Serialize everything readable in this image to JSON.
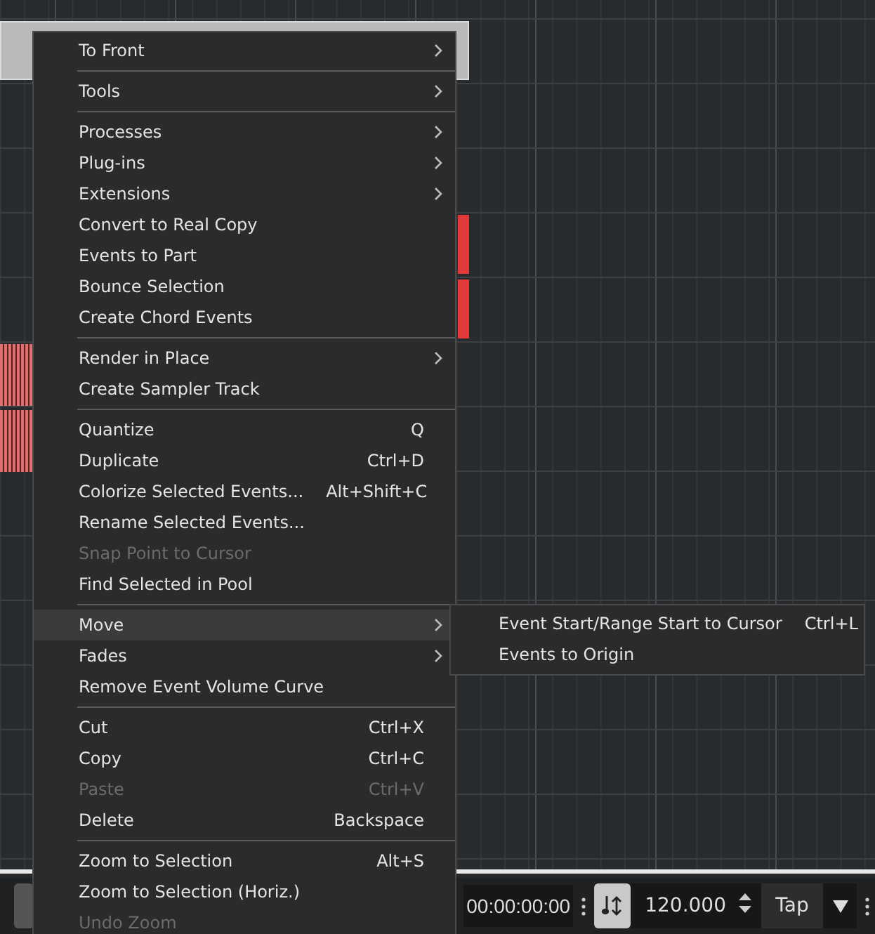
{
  "context_menu": {
    "sections": [
      [
        {
          "label": "To Front",
          "has_submenu": true,
          "disabled": false,
          "selected": false
        }
      ],
      [
        {
          "label": "Tools",
          "has_submenu": true,
          "disabled": false,
          "selected": false
        }
      ],
      [
        {
          "label": "Processes",
          "has_submenu": true,
          "disabled": false,
          "selected": false
        },
        {
          "label": "Plug-ins",
          "has_submenu": true,
          "disabled": false,
          "selected": false
        },
        {
          "label": "Extensions",
          "has_submenu": true,
          "disabled": false,
          "selected": false
        },
        {
          "label": "Convert to Real Copy",
          "has_submenu": false,
          "disabled": false,
          "selected": false
        },
        {
          "label": "Events to Part",
          "has_submenu": false,
          "disabled": false,
          "selected": false
        },
        {
          "label": "Bounce Selection",
          "has_submenu": false,
          "disabled": false,
          "selected": false
        },
        {
          "label": "Create Chord Events",
          "has_submenu": false,
          "disabled": false,
          "selected": false
        }
      ],
      [
        {
          "label": "Render in Place",
          "has_submenu": true,
          "disabled": false,
          "selected": false
        },
        {
          "label": "Create Sampler Track",
          "has_submenu": false,
          "disabled": false,
          "selected": false
        }
      ],
      [
        {
          "label": "Quantize",
          "shortcut": "Q",
          "has_submenu": false,
          "disabled": false,
          "selected": false
        },
        {
          "label": "Duplicate",
          "shortcut": "Ctrl+D",
          "has_submenu": false,
          "disabled": false,
          "selected": false
        },
        {
          "label": "Colorize Selected Events...",
          "shortcut": "Alt+Shift+C",
          "has_submenu": false,
          "disabled": false,
          "selected": false
        },
        {
          "label": "Rename Selected Events...",
          "has_submenu": false,
          "disabled": false,
          "selected": false
        },
        {
          "label": "Snap Point to Cursor",
          "has_submenu": false,
          "disabled": true,
          "selected": false
        },
        {
          "label": "Find Selected in Pool",
          "has_submenu": false,
          "disabled": false,
          "selected": false
        }
      ],
      [
        {
          "label": "Move",
          "has_submenu": true,
          "disabled": false,
          "selected": true
        },
        {
          "label": "Fades",
          "has_submenu": true,
          "disabled": false,
          "selected": false
        },
        {
          "label": "Remove Event Volume Curve",
          "has_submenu": false,
          "disabled": false,
          "selected": false
        }
      ],
      [
        {
          "label": "Cut",
          "shortcut": "Ctrl+X",
          "has_submenu": false,
          "disabled": false,
          "selected": false
        },
        {
          "label": "Copy",
          "shortcut": "Ctrl+C",
          "has_submenu": false,
          "disabled": false,
          "selected": false
        },
        {
          "label": "Paste",
          "shortcut": "Ctrl+V",
          "has_submenu": false,
          "disabled": true,
          "selected": false
        },
        {
          "label": "Delete",
          "shortcut": "Backspace",
          "has_submenu": false,
          "disabled": false,
          "selected": false
        }
      ],
      [
        {
          "label": "Zoom to Selection",
          "shortcut": "Alt+S",
          "has_submenu": false,
          "disabled": false,
          "selected": false
        },
        {
          "label": "Zoom to Selection (Horiz.)",
          "has_submenu": false,
          "disabled": false,
          "selected": false
        },
        {
          "label": "Undo Zoom",
          "has_submenu": false,
          "disabled": true,
          "selected": false
        }
      ]
    ]
  },
  "submenu": {
    "items": [
      {
        "label": "Event Start/Range Start to Cursor",
        "shortcut": "Ctrl+L"
      },
      {
        "label": "Events to Origin"
      }
    ]
  },
  "transport": {
    "time": "00:00:00:00",
    "tempo": "120.000",
    "tap_button": "Tap"
  }
}
